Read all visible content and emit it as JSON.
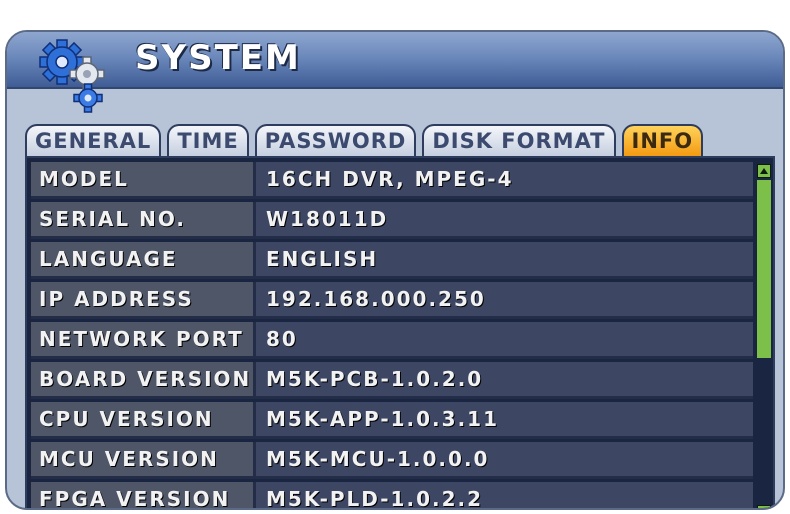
{
  "window": {
    "title": "SYSTEM",
    "icon": "gears-icon"
  },
  "tabs": [
    {
      "label": "GENERAL",
      "active": false
    },
    {
      "label": "TIME",
      "active": false
    },
    {
      "label": "PASSWORD",
      "active": false
    },
    {
      "label": "DISK FORMAT",
      "active": false
    },
    {
      "label": "INFO",
      "active": true
    }
  ],
  "info": {
    "rows": [
      {
        "label": "MODEL",
        "value": "16CH DVR, MPEG-4"
      },
      {
        "label": "SERIAL NO.",
        "value": "W18011D"
      },
      {
        "label": "LANGUAGE",
        "value": "ENGLISH"
      },
      {
        "label": "IP ADDRESS",
        "value": "192.168.000.250"
      },
      {
        "label": "NETWORK PORT",
        "value": "80"
      },
      {
        "label": "BOARD VERSION",
        "value": "M5K-PCB-1.0.2.0"
      },
      {
        "label": "CPU VERSION",
        "value": "M5K-APP-1.0.3.11"
      },
      {
        "label": "MCU VERSION",
        "value": "M5K-MCU-1.0.0.0"
      },
      {
        "label": "FPGA VERSION",
        "value": "M5K-PLD-1.0.2.2"
      }
    ]
  },
  "scrollbar": {
    "thumb_fraction": 0.5,
    "thumb_position": 0.0
  },
  "colors": {
    "active_tab": "#f39a12",
    "scroll_green": "#7cc04a",
    "panel_bg": "#1a2542"
  }
}
